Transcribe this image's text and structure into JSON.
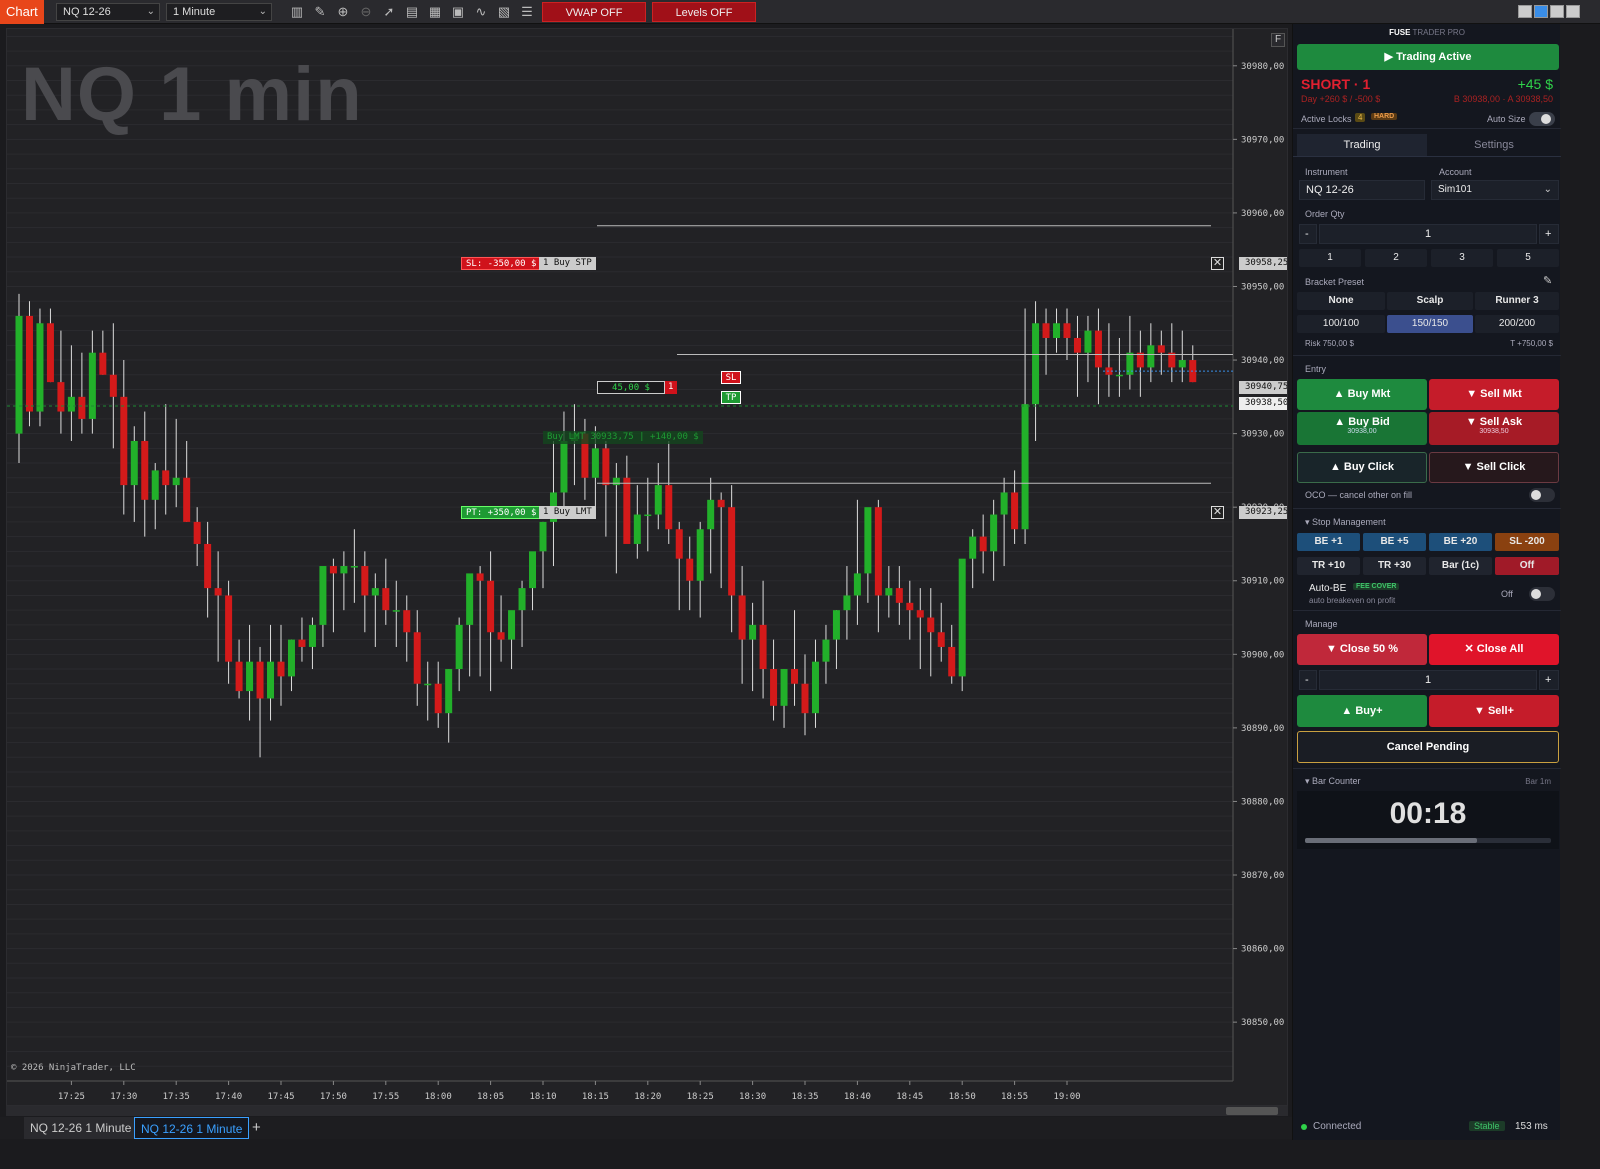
{
  "toolbar": {
    "app_tab": "Chart",
    "instrument": "NQ 12-26",
    "interval": "1 Minute",
    "vwap_button": "VWAP OFF",
    "levels_button": "Levels OFF",
    "icons": [
      "bar-style-icon",
      "draw-tool-icon",
      "zoom-in-icon",
      "zoom-out-icon",
      "pointer-icon",
      "properties-icon",
      "templates-icon",
      "data-box-icon",
      "indicators-icon",
      "strategies-icon",
      "order-list-icon"
    ]
  },
  "chart": {
    "watermark": "NQ 1 min",
    "copyright": "© 2026 NinjaTrader, LLC",
    "f_button": "F",
    "sl_order": {
      "label": "SL: -350,00 $",
      "tag": "1 Buy STP",
      "price": "30958,25"
    },
    "pt_order": {
      "label": "PT: +350,00 $",
      "tag": "1 Buy LMT",
      "price": "30923,25"
    },
    "position": {
      "pnl": "45,00 $",
      "qty": "1",
      "price": "30940,75",
      "sl_btn": "SL",
      "tp_btn": "TP"
    },
    "ghost_order": "Buy LMT  30933,75 | +140,00 $",
    "last_price": "30938,50"
  },
  "chart_data": {
    "type": "candlestick",
    "title": "NQ 1 min",
    "y_ticks": [
      "30980,00",
      "30970,00",
      "30960,00",
      "30950,00",
      "30940,00",
      "30930,00",
      "30920,00",
      "30910,00",
      "30900,00",
      "30890,00",
      "30880,00",
      "30870,00",
      "30860,00",
      "30850,00"
    ],
    "x_ticks": [
      "17:25",
      "17:30",
      "17:35",
      "17:40",
      "17:45",
      "17:50",
      "17:55",
      "18:00",
      "18:05",
      "18:10",
      "18:15",
      "18:20",
      "18:25",
      "18:30",
      "18:35",
      "18:40",
      "18:45",
      "18:50",
      "18:55",
      "19:00"
    ],
    "ylim": [
      30842,
      30985
    ],
    "ohlc": [
      [
        30930,
        30949,
        30926,
        30946
      ],
      [
        30946,
        30948,
        30931,
        30933
      ],
      [
        30933,
        30947,
        30931,
        30945
      ],
      [
        30945,
        30947,
        30937,
        30937
      ],
      [
        30937,
        30944,
        30930,
        30933
      ],
      [
        30933,
        30942,
        30929,
        30935
      ],
      [
        30935,
        30941,
        30930,
        30932
      ],
      [
        30932,
        30944,
        30930,
        30941
      ],
      [
        30941,
        30944,
        30938,
        30938
      ],
      [
        30938,
        30945,
        30928,
        30935
      ],
      [
        30935,
        30940,
        30919,
        30923
      ],
      [
        30923,
        30931,
        30918,
        30929
      ],
      [
        30929,
        30933,
        30916,
        30921
      ],
      [
        30921,
        30926,
        30917,
        30925
      ],
      [
        30925,
        30934,
        30919,
        30923
      ],
      [
        30923,
        30932,
        30920,
        30924
      ],
      [
        30924,
        30929,
        30918,
        30918
      ],
      [
        30918,
        30920,
        30912,
        30915
      ],
      [
        30915,
        30918,
        30905,
        30909
      ],
      [
        30909,
        30914,
        30899,
        30908
      ],
      [
        30908,
        30910,
        30896,
        30899
      ],
      [
        30899,
        30902,
        30894,
        30895
      ],
      [
        30895,
        30904,
        30891,
        30899
      ],
      [
        30899,
        30901,
        30886,
        30894
      ],
      [
        30894,
        30904,
        30891,
        30899
      ],
      [
        30899,
        30904,
        30893,
        30897
      ],
      [
        30897,
        30902,
        30895,
        30902
      ],
      [
        30902,
        30905,
        30899,
        30901
      ],
      [
        30901,
        30905,
        30898,
        30904
      ],
      [
        30904,
        30910,
        30901,
        30912
      ],
      [
        30912,
        30913,
        30903,
        30911
      ],
      [
        30911,
        30914,
        30906,
        30912
      ],
      [
        30912,
        30917,
        30907,
        30912
      ],
      [
        30912,
        30914,
        30903,
        30908
      ],
      [
        30908,
        30911,
        30901,
        30909
      ],
      [
        30909,
        30913,
        30904,
        30906
      ],
      [
        30906,
        30910,
        30901,
        30906
      ],
      [
        30906,
        30908,
        30899,
        30903
      ],
      [
        30903,
        30906,
        30893,
        30896
      ],
      [
        30896,
        30899,
        30891,
        30896
      ],
      [
        30896,
        30899,
        30890,
        30892
      ],
      [
        30892,
        30898,
        30888,
        30898
      ],
      [
        30898,
        30905,
        30895,
        30904
      ],
      [
        30904,
        30909,
        30897,
        30911
      ],
      [
        30911,
        30912,
        30897,
        30910
      ],
      [
        30910,
        30914,
        30895,
        30903
      ],
      [
        30903,
        30908,
        30899,
        30902
      ],
      [
        30902,
        30904,
        30898,
        30906
      ],
      [
        30906,
        30910,
        30901,
        30909
      ],
      [
        30909,
        30913,
        30906,
        30914
      ],
      [
        30914,
        30918,
        30909,
        30918
      ],
      [
        30918,
        30929,
        30912,
        30922
      ],
      [
        30922,
        30933,
        30919,
        30929
      ],
      [
        30929,
        30934,
        30923,
        30930
      ],
      [
        30930,
        30932,
        30921,
        30924
      ],
      [
        30924,
        30931,
        30920,
        30928
      ],
      [
        30928,
        30929,
        30916,
        30923
      ],
      [
        30923,
        30926,
        30911,
        30924
      ],
      [
        30924,
        30927,
        30920,
        30915
      ],
      [
        30915,
        30923,
        30913,
        30919
      ],
      [
        30919,
        30924,
        30914,
        30919
      ],
      [
        30919,
        30926,
        30917,
        30923
      ],
      [
        30923,
        30929,
        30915,
        30917
      ],
      [
        30917,
        30918,
        30906,
        30913
      ],
      [
        30913,
        30916,
        30906,
        30910
      ],
      [
        30910,
        30918,
        30905,
        30917
      ],
      [
        30917,
        30924,
        30911,
        30921
      ],
      [
        30921,
        30922,
        30909,
        30920
      ],
      [
        30920,
        30923,
        30903,
        30908
      ],
      [
        30908,
        30912,
        30896,
        30902
      ],
      [
        30902,
        30907,
        30895,
        30904
      ],
      [
        30904,
        30910,
        30894,
        30898
      ],
      [
        30898,
        30902,
        30891,
        30893
      ],
      [
        30893,
        30898,
        30890,
        30898
      ],
      [
        30898,
        30906,
        30893,
        30896
      ],
      [
        30896,
        30900,
        30889,
        30892
      ],
      [
        30892,
        30902,
        30890,
        30899
      ],
      [
        30899,
        30904,
        30896,
        30902
      ],
      [
        30902,
        30906,
        30898,
        30906
      ],
      [
        30906,
        30912,
        30902,
        30908
      ],
      [
        30908,
        30921,
        30904,
        30911
      ],
      [
        30911,
        30919,
        30907,
        30920
      ],
      [
        30920,
        30921,
        30903,
        30908
      ],
      [
        30908,
        30912,
        30905,
        30909
      ],
      [
        30909,
        30912,
        30904,
        30907
      ],
      [
        30907,
        30910,
        30902,
        30906
      ],
      [
        30906,
        30909,
        30898,
        30905
      ],
      [
        30905,
        30909,
        30897,
        30903
      ],
      [
        30903,
        30907,
        30899,
        30901
      ],
      [
        30901,
        30904,
        30896,
        30897
      ],
      [
        30897,
        30912,
        30895,
        30913
      ],
      [
        30913,
        30917,
        30909,
        30916
      ],
      [
        30916,
        30919,
        30911,
        30914
      ],
      [
        30914,
        30921,
        30910,
        30919
      ],
      [
        30919,
        30924,
        30912,
        30922
      ],
      [
        30922,
        30925,
        30915,
        30917
      ],
      [
        30917,
        30947,
        30915,
        30934
      ],
      [
        30934,
        30948,
        30929,
        30945
      ],
      [
        30945,
        30947,
        30938,
        30943
      ],
      [
        30943,
        30947,
        30941,
        30945
      ],
      [
        30945,
        30947,
        30940,
        30943
      ],
      [
        30943,
        30946,
        30935,
        30941
      ],
      [
        30941,
        30946,
        30937,
        30944
      ],
      [
        30944,
        30947,
        30934,
        30939
      ],
      [
        30939,
        30945,
        30935,
        30938
      ],
      [
        30938,
        30943,
        30935,
        30938
      ],
      [
        30938,
        30946,
        30936,
        30941
      ],
      [
        30941,
        30944,
        30935,
        30939
      ],
      [
        30939,
        30945,
        30937,
        30942
      ],
      [
        30942,
        30944,
        30938,
        30941
      ],
      [
        30941,
        30945,
        30937,
        30939
      ],
      [
        30939,
        30944,
        30937,
        30940
      ],
      [
        30940,
        30942,
        30937,
        30937
      ]
    ]
  },
  "bottom_tabs": [
    "NQ 12-26 1 Minute",
    "NQ 12-26 1 Minute",
    "+"
  ],
  "panel": {
    "brand": "FUSE",
    "brand_suffix": "TRADER PRO",
    "trading_active": "▶  Trading Active",
    "position_label": "SHORT · 1",
    "position_pnl": "+45 $",
    "day_stats": "Day +260 $ / -500 $",
    "bid_ask": "B 30938,00 · A 30938,50",
    "active_locks": "Active Locks",
    "locks_count": "4",
    "hard_badge": "HARD",
    "auto_size": "Auto Size",
    "tabs": [
      "Trading",
      "Settings"
    ],
    "instrument_label": "Instrument",
    "instrument_value": "NQ 12-26",
    "account_label": "Account",
    "account_value": "Sim101",
    "order_qty_label": "Order Qty",
    "qty_minus": "-",
    "qty_value": "1",
    "qty_plus": "+",
    "qty_presets": [
      "1",
      "2",
      "3",
      "5"
    ],
    "bracket_label": "Bracket Preset",
    "bracket_row1": [
      "None",
      "Scalp",
      "Runner 3"
    ],
    "bracket_row2": [
      "100/100",
      "150/150",
      "200/200"
    ],
    "risk": "Risk 750,00 $",
    "target": "T +750,00 $",
    "entry_label": "Entry",
    "buy_mkt": "▲  Buy Mkt",
    "sell_mkt": "▼  Sell Mkt",
    "buy_bid": "▲  Buy Bid",
    "buy_bid_price": "30938,00",
    "sell_ask": "▼  Sell Ask",
    "sell_ask_price": "30938,50",
    "buy_click": "▲  Buy Click",
    "sell_click": "▼  Sell Click",
    "oco_label": "OCO — cancel other on fill",
    "stop_mgmt_label": "▾  Stop Management",
    "stop_row1": [
      "BE +1",
      "BE +5",
      "BE +20",
      "SL -200"
    ],
    "stop_row2": [
      "TR +10",
      "TR +30",
      "Bar (1c)",
      "Off"
    ],
    "auto_be_label": "Auto-BE",
    "fee_cover": "FEE COVER",
    "auto_be_sub": "auto breakeven on profit",
    "auto_be_state": "Off",
    "manage_label": "Manage",
    "close_50": "▼  Close 50 %",
    "close_all": "✕  Close All",
    "manage_qty": "1",
    "buy_plus": "▲  Buy+",
    "sell_plus": "▼  Sell+",
    "cancel_pending": "Cancel Pending",
    "bar_counter_label": "▾  Bar Counter",
    "bar_counter_tf": "Bar 1m",
    "bar_timer": "00:18",
    "bar_progress": 0.7,
    "status": "Connected",
    "stable": "Stable",
    "latency": "153 ms"
  },
  "colors": {
    "up": "#22b02a",
    "down": "#d41a1a",
    "accent": "#e8461a",
    "panel_bg": "#14171f"
  }
}
